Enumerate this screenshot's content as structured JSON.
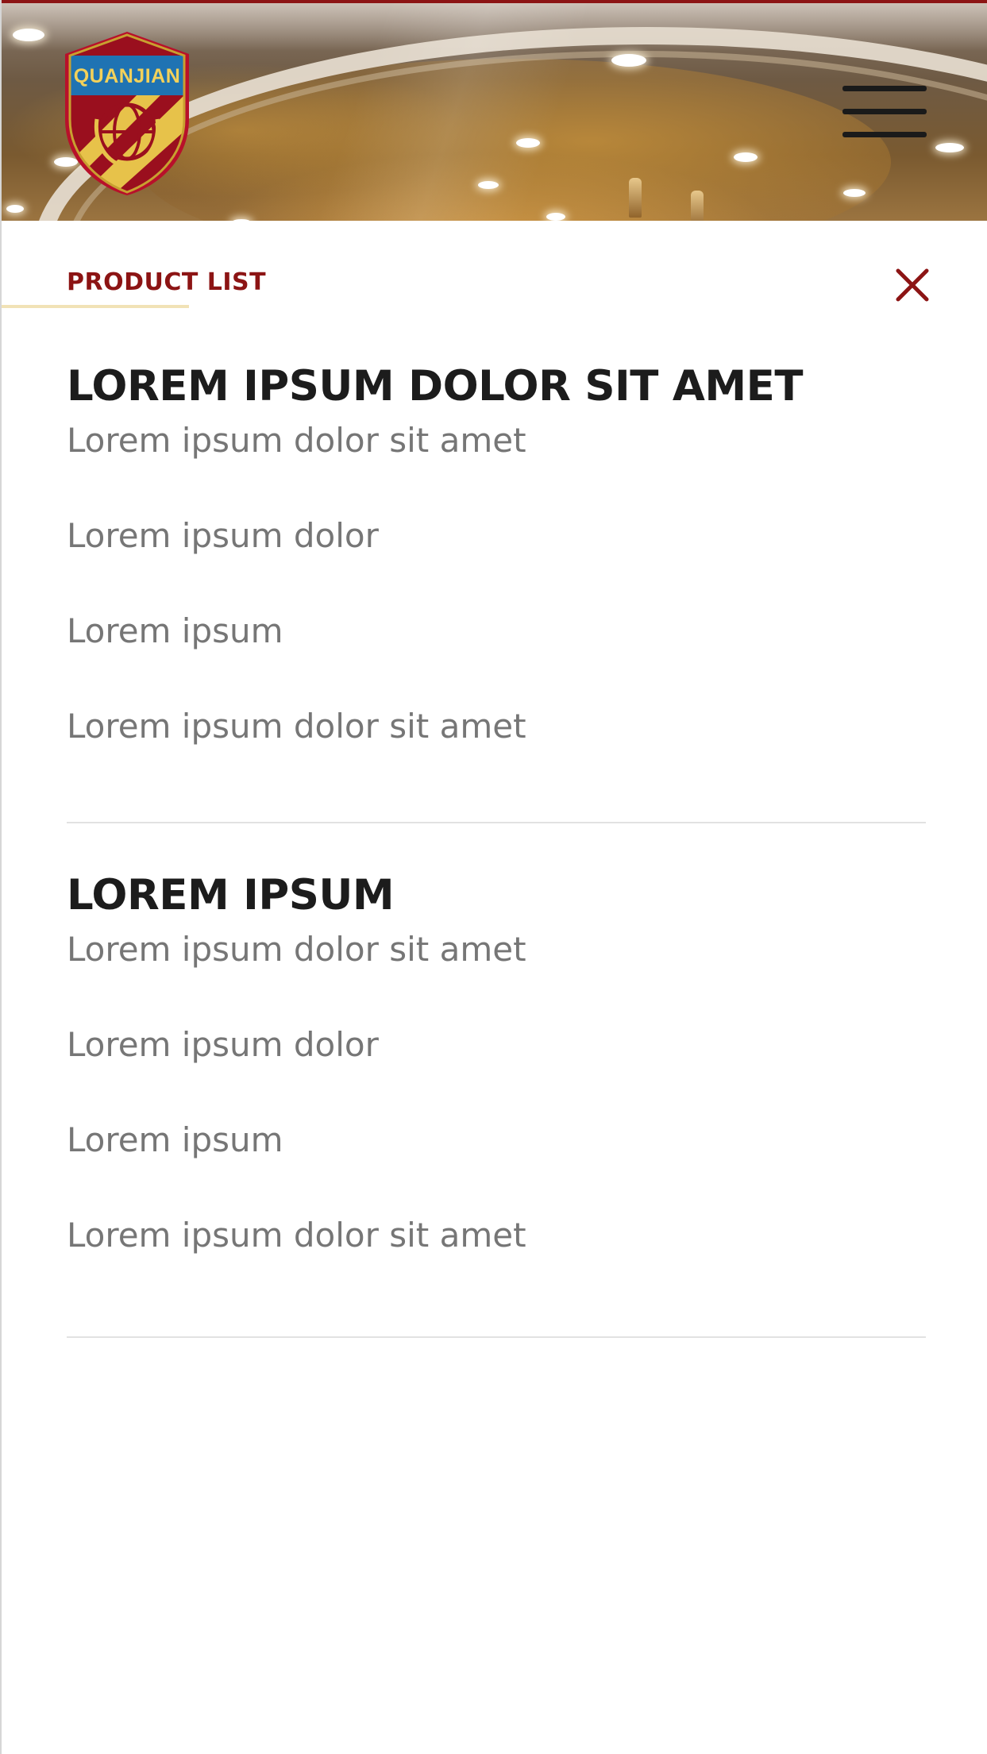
{
  "header": {
    "logo_text": "QUANJIAN",
    "menu_icon": "hamburger-menu-icon"
  },
  "panel": {
    "title": "PRODUCT LIST",
    "close_icon": "close-icon",
    "accent_color": "#8c1414",
    "underline_color": "#f1e2b6"
  },
  "sections": [
    {
      "heading": "LOREM IPSUM DOLOR SIT AMET",
      "items": [
        "Lorem ipsum dolor sit amet",
        "Lorem ipsum dolor",
        "Lorem ipsum",
        "Lorem ipsum dolor sit amet"
      ]
    },
    {
      "heading": "LOREM IPSUM",
      "items": [
        "Lorem ipsum dolor sit amet",
        "Lorem ipsum dolor",
        "Lorem ipsum",
        "Lorem ipsum dolor sit amet"
      ]
    }
  ]
}
